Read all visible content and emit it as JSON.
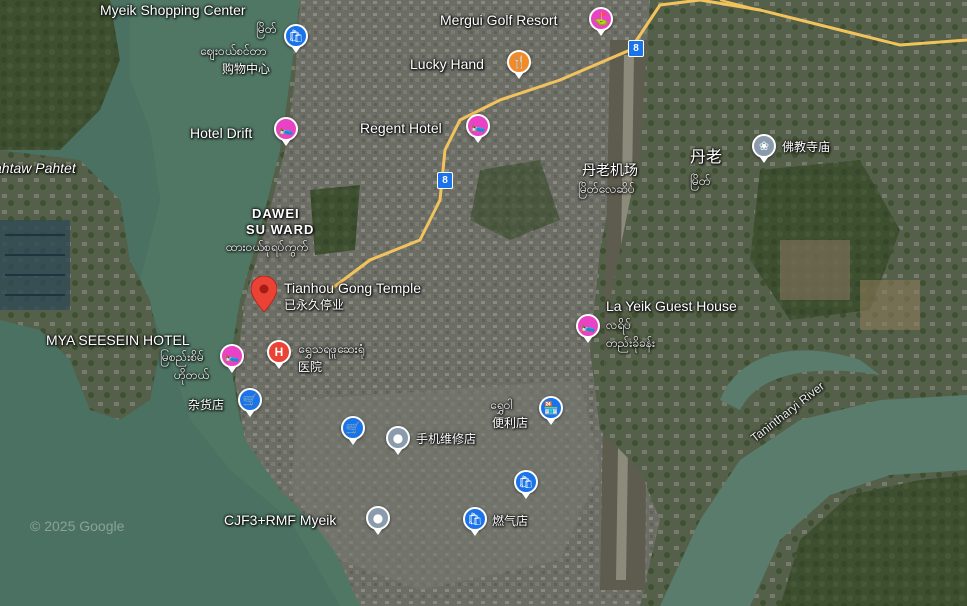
{
  "colors": {
    "shopping": "#1a73e8",
    "hotel": "#e942c4",
    "food": "#f28a27",
    "golf": "#e942c4",
    "hospital": "#ea4335",
    "generic": "#8a9bab",
    "road": "#f2c35c",
    "water": "#4f7563"
  },
  "labels": {
    "shopping_center_en": "Myeik Shopping Center",
    "shopping_center_my": "မြိတ်",
    "shopping_center_my2": "ဈေးဝယ်စင်တာ",
    "shopping_center_zh": "购物中心",
    "hotel_drift": "Hotel Drift",
    "regent_hotel": "Regent Hotel",
    "mergui_golf": "Mergui Golf Resort",
    "lucky_hand": "Lucky Hand",
    "airport_zh": "丹老机场",
    "airport_my": "မြိတ်လေဆိပ်",
    "city_zh": "丹老",
    "city_my": "မြိတ်",
    "buddhist_temple": "佛教寺庙",
    "ward_line1": "DAWEI",
    "ward_line2": "SU WARD",
    "ward_my": "ထားဝယ်စုရပ်ကွက်",
    "tianhou_temple": "Tianhou Gong Temple",
    "tianhou_status": "已永久停业",
    "la_yeik_en": "La Yeik Guest House",
    "la_yeik_my1": "လရိပ်",
    "la_yeik_my2": "တည်းခိုခန်း",
    "mya_seesein_en": "MYA SEESEIN HOTEL",
    "mya_seesein_my1": "မြစည်းစိမ်",
    "mya_seesein_my2": "ဟိုတယ်",
    "hospital_my": "ရွှေသရဖူဆေးရုံ",
    "hospital_zh": "医院",
    "grocery_zh": "杂货店",
    "convenience_my": "ရွှေဝါ",
    "convenience_zh": "便利店",
    "phone_repair_zh": "手机维修店",
    "plus_code": "CJF3+RMF Myeik",
    "gas_store_zh": "燃气店",
    "river": "Tanintharyi River",
    "highway_a": "8",
    "highway_b": "8",
    "watermark": "© 2025 Google"
  },
  "icons": {
    "shopping": "shopping-bag-icon",
    "hotel": "bed-icon",
    "food": "restaurant-icon",
    "golf": "golf-icon",
    "hospital": "hospital-icon",
    "grocery": "shopping-cart-icon",
    "store": "storefront-icon",
    "temple": "temple-icon",
    "location": "location-dot-icon",
    "selected": "red-location-pin-icon"
  }
}
